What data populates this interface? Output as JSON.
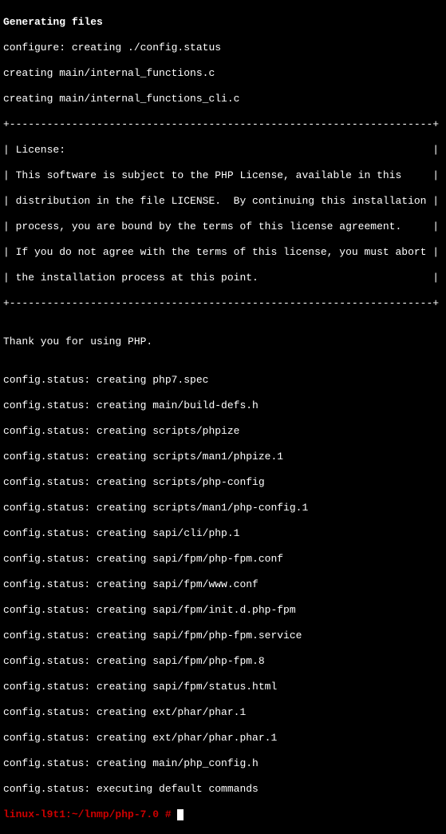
{
  "lines": {
    "l0": "Generating files",
    "l1": "configure: creating ./config.status",
    "l2": "creating main/internal_functions.c",
    "l3": "creating main/internal_functions_cli.c",
    "l4": "+--------------------------------------------------------------------+",
    "l5": "| License:                                                           |",
    "l6": "| This software is subject to the PHP License, available in this     |",
    "l7": "| distribution in the file LICENSE.  By continuing this installation |",
    "l8": "| process, you are bound by the terms of this license agreement.     |",
    "l9": "| If you do not agree with the terms of this license, you must abort |",
    "l10": "| the installation process at this point.                            |",
    "l11": "+--------------------------------------------------------------------+",
    "l12": "",
    "l13": "Thank you for using PHP.",
    "l14": "",
    "l15": "config.status: creating php7.spec",
    "l16": "config.status: creating main/build-defs.h",
    "l17": "config.status: creating scripts/phpize",
    "l18": "config.status: creating scripts/man1/phpize.1",
    "l19": "config.status: creating scripts/php-config",
    "l20": "config.status: creating scripts/man1/php-config.1",
    "l21": "config.status: creating sapi/cli/php.1",
    "l22": "config.status: creating sapi/fpm/php-fpm.conf",
    "l23": "config.status: creating sapi/fpm/www.conf",
    "l24": "config.status: creating sapi/fpm/init.d.php-fpm",
    "l25": "config.status: creating sapi/fpm/php-fpm.service",
    "l26": "config.status: creating sapi/fpm/php-fpm.8",
    "l27": "config.status: creating sapi/fpm/status.html",
    "l28": "config.status: creating ext/phar/phar.1",
    "l29": "config.status: creating ext/phar/phar.phar.1",
    "l30": "config.status: creating main/php_config.h",
    "l31": "config.status: executing default commands"
  },
  "prompt": {
    "text": "linux-l9t1:~/lnmp/php-7.0 # "
  }
}
